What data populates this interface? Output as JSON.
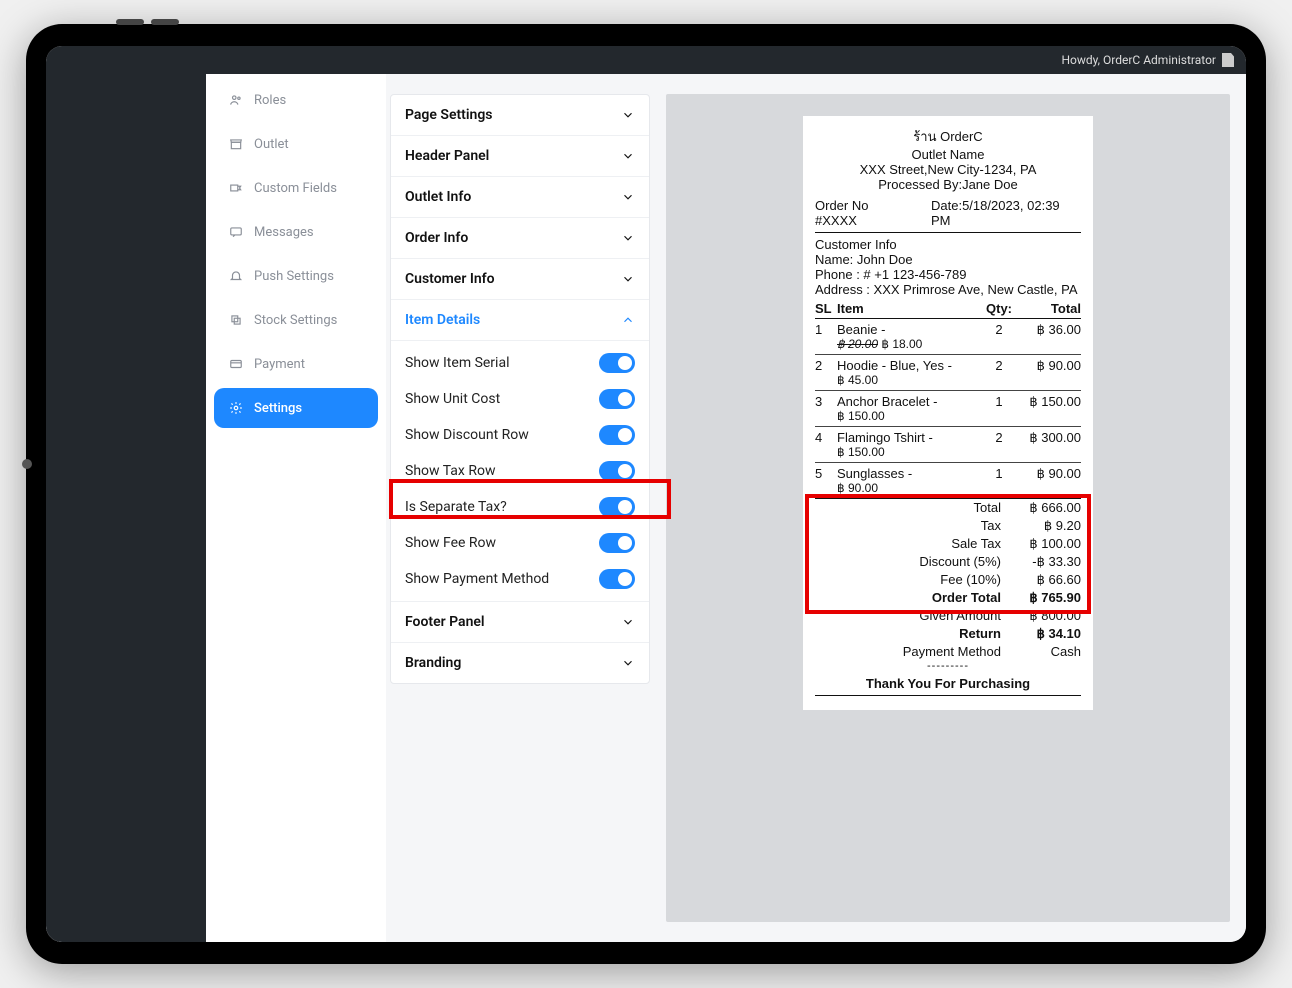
{
  "admin_greeting": "Howdy, OrderC Administrator",
  "sidebar": {
    "items": [
      {
        "label": "Roles",
        "icon": "users"
      },
      {
        "label": "Outlet",
        "icon": "store"
      },
      {
        "label": "Custom Fields",
        "icon": "tag"
      },
      {
        "label": "Messages",
        "icon": "message"
      },
      {
        "label": "Push Settings",
        "icon": "bell"
      },
      {
        "label": "Stock Settings",
        "icon": "layers"
      },
      {
        "label": "Payment",
        "icon": "card"
      },
      {
        "label": "Settings",
        "icon": "gear"
      }
    ]
  },
  "accordion": {
    "page_settings": "Page Settings",
    "header_panel": "Header Panel",
    "outlet_info": "Outlet Info",
    "order_info": "Order Info",
    "customer_info": "Customer Info",
    "item_details": "Item Details",
    "footer_panel": "Footer Panel",
    "branding": "Branding"
  },
  "options": {
    "show_item_serial": "Show Item Serial",
    "show_unit_cost": "Show Unit Cost",
    "show_discount_row": "Show Discount Row",
    "show_tax_row": "Show Tax Row",
    "is_separate_tax": "Is Separate Tax?",
    "show_fee_row": "Show Fee Row",
    "show_payment_method": "Show Payment Method"
  },
  "receipt": {
    "store_name": "ร้าน OrderC",
    "outlet_name": "Outlet Name",
    "address": "XXX Street,New City-1234, PA",
    "processed_by_label": "Processed By:",
    "processed_by_name": "Jane Doe",
    "order_no_label": "Order No",
    "order_no_value": "#XXXX",
    "date_label": "Date:",
    "date_value": "5/18/2023, 02:39 PM",
    "customer_info_header": "Customer Info",
    "cust_name_label": "Name: ",
    "cust_name": "John Doe",
    "cust_phone_label": "Phone : # ",
    "cust_phone": "+1 123-456-789",
    "cust_addr_label": "Address : ",
    "cust_addr": "XXX Primrose Ave, New Castle, PA",
    "cols": {
      "sl": "SL",
      "item": "Item",
      "qty": "Qty:",
      "total": "Total"
    },
    "items": [
      {
        "sl": "1",
        "name": "Beanie -",
        "price_strike": "฿ 20.00",
        "price": "฿ 18.00",
        "qty": "2",
        "total": "฿ 36.00"
      },
      {
        "sl": "2",
        "name": "Hoodie - Blue, Yes -",
        "price": "฿ 45.00",
        "qty": "2",
        "total": "฿ 90.00"
      },
      {
        "sl": "3",
        "name": "Anchor Bracelet -",
        "price": "฿ 150.00",
        "qty": "1",
        "total": "฿ 150.00"
      },
      {
        "sl": "4",
        "name": "Flamingo Tshirt -",
        "price": "฿ 150.00",
        "qty": "2",
        "total": "฿ 300.00"
      },
      {
        "sl": "5",
        "name": "Sunglasses -",
        "price": "฿ 90.00",
        "qty": "1",
        "total": "฿ 90.00"
      }
    ],
    "totals": {
      "total_label": "Total",
      "total_value": "฿ 666.00",
      "tax_label": "Tax",
      "tax_value": "฿ 9.20",
      "sale_tax_label": "Sale Tax",
      "sale_tax_value": "฿ 100.00",
      "discount_label": "Discount (5%)",
      "discount_value": "-฿ 33.30",
      "fee_label": "Fee (10%)",
      "fee_value": "฿ 66.60",
      "order_total_label": "Order Total",
      "order_total_value": "฿ 765.90",
      "given_label": "Given Amount",
      "given_value": "฿ 800.00",
      "return_label": "Return",
      "return_value": "฿ 34.10",
      "pay_method_label": "Payment Method",
      "pay_method_value": "Cash"
    },
    "dashes": "---------",
    "thankyou": "Thank You For Purchasing"
  }
}
